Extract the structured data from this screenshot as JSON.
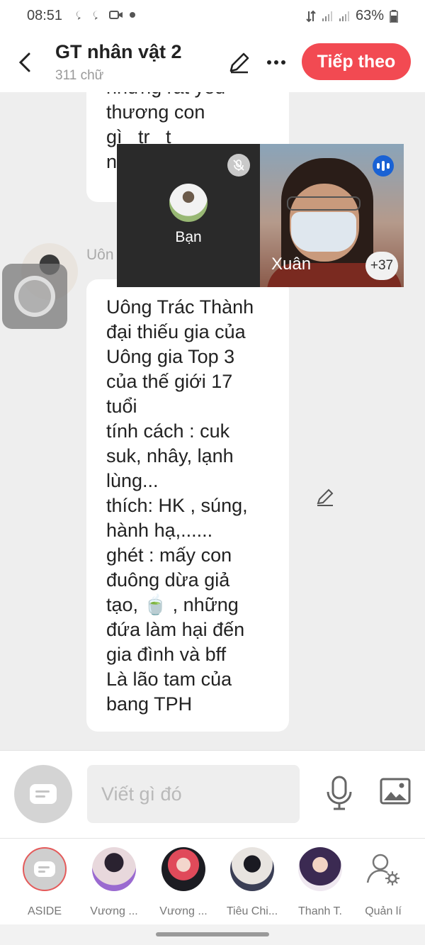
{
  "status_bar": {
    "time": "08:51",
    "battery": "63%",
    "icons": [
      "chat-bubble-icon",
      "chat-bubble-icon",
      "video-camera-icon",
      "dot-icon",
      "data-arrows-icon",
      "signal-icon",
      "signal-icon",
      "battery-icon"
    ]
  },
  "header": {
    "title": "GT nhân vật 2",
    "subtitle": "311 chữ",
    "next_label": "Tiếp theo"
  },
  "messages": {
    "first_text": "nhưng rất yêu\nthương con\ngì   tr   t \nn",
    "sender": "Uôn",
    "second_text": "Uông Trác Thành\nđại thiếu gia của\nUông gia Top 3\ncủa thế giới 17\ntuổi\ntính cách : cuk\nsuk, nhây, lạnh\nlùng...\nthích: HK , súng,\nhành hạ,......\nghét : mấy con\nđuông dừa giả\ntạo, 🍵 , những\nđứa làm hại đến\ngia đình và bff\nLà lão tam của\nbang TPH"
  },
  "call": {
    "self_name": "Bạn",
    "remote_name": "Xuân",
    "others_count": "+37"
  },
  "composer": {
    "placeholder": "Viết gì đó"
  },
  "characters": [
    {
      "label": "ASIDE"
    },
    {
      "label": "Vương ..."
    },
    {
      "label": "Vương ..."
    },
    {
      "label": "Tiêu Chi..."
    },
    {
      "label": "Thanh T."
    },
    {
      "label": "Quản lí"
    }
  ],
  "colors": {
    "accent": "#f24a52",
    "background": "#eeeeee",
    "speaking": "#1a62d4"
  }
}
